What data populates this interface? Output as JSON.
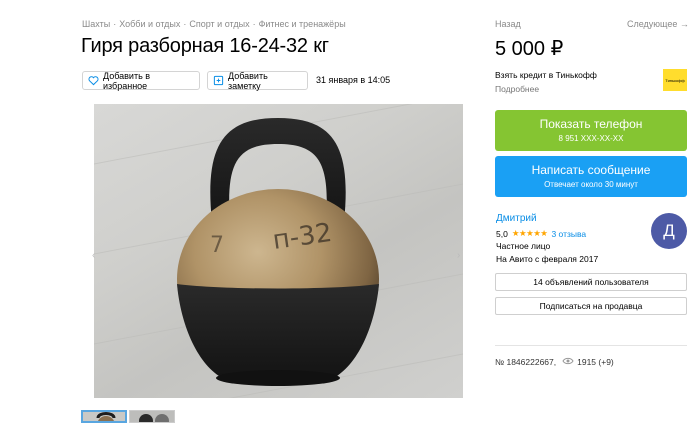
{
  "breadcrumbs": [
    "Шахты",
    "Хобби и отдых",
    "Спорт и отдых",
    "Фитнес и тренажёры"
  ],
  "breadcrumb_sep": "·",
  "title": "Гиря разборная 16-24-32 кг",
  "actions": {
    "favorite_label": "Добавить в избранное",
    "note_label": "Добавить заметку"
  },
  "date": "31 января в 14:05",
  "nav": {
    "back": "Назад",
    "next": "Следующее →"
  },
  "price": "5 000 ₽",
  "credit": {
    "title": "Взять кредит в Тинькофф",
    "details": "Подробнее",
    "bank_logo": "Тинькофф"
  },
  "phone_button": {
    "label": "Показать телефон",
    "number": "8 951 XXX-XX-XX"
  },
  "message_button": {
    "label": "Написать сообщение",
    "reply_time": "Отвечает около 30 минут"
  },
  "seller": {
    "name": "Дмитрий",
    "rating": "5,0",
    "stars": "★★★★★",
    "reviews": "3 отзыва",
    "type": "Частное лицо",
    "since": "На Авито с февраля 2017",
    "avatar_letter": "Д"
  },
  "user_ads_button": "14 объявлений пользователя",
  "subscribe_button": "Подписаться на продавца",
  "ad_number": "№ 1846222667,",
  "views": "1915 (+9)",
  "colors": {
    "phone": "#85c532",
    "message": "#1aa0f4",
    "link": "#0a8ee6",
    "avatar": "#4d5aa6",
    "stars": "#ffa500"
  },
  "icons": {
    "favorite": "heart-icon",
    "note": "note-icon",
    "views": "eye-icon",
    "prev": "chevron-left-icon",
    "next": "chevron-right-icon"
  }
}
